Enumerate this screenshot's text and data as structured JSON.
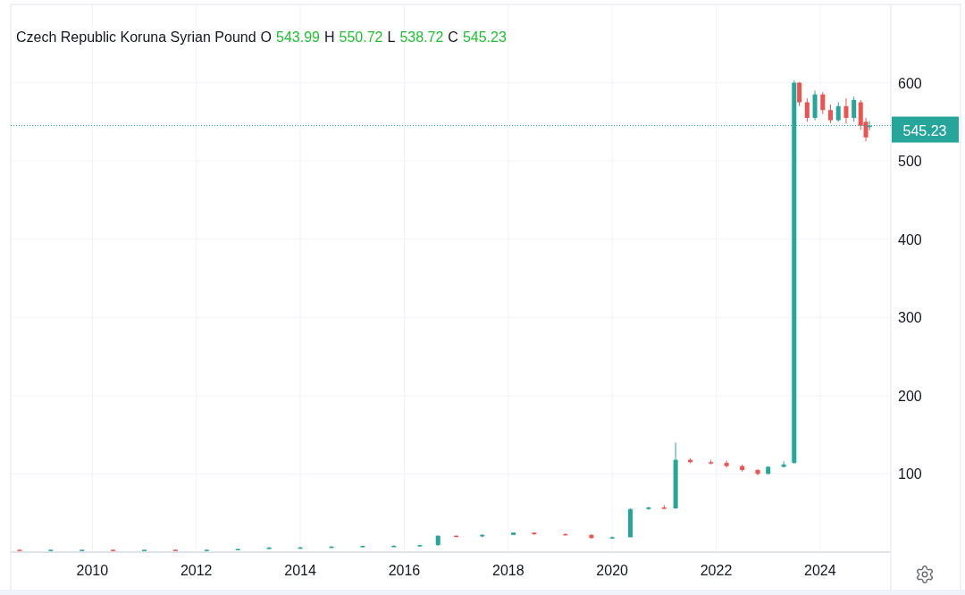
{
  "legend": {
    "fields": [
      {
        "label": "O",
        "value": "543.99"
      },
      {
        "label": "H",
        "value": "550.72"
      },
      {
        "label": "L",
        "value": "538.72"
      },
      {
        "label": "C",
        "value": "545.23"
      }
    ]
  },
  "price_label": "545.23",
  "chart_data": {
    "type": "candlestick",
    "title": "Czech Republic Koruna Syrian Pound",
    "grid": true,
    "ref_lines": [
      {
        "axis": "y",
        "value": 545.23
      }
    ],
    "xlim": [
      2008.43,
      2025.36
    ],
    "ylim": [
      0,
      700
    ],
    "xticks": [
      {
        "value": 2010,
        "label": "2010"
      },
      {
        "value": 2012,
        "label": "2012"
      },
      {
        "value": 2014,
        "label": "2014"
      },
      {
        "value": 2016,
        "label": "2016"
      },
      {
        "value": 2018,
        "label": "2018"
      },
      {
        "value": 2020,
        "label": "2020"
      },
      {
        "value": 2022,
        "label": "2022"
      },
      {
        "value": 2024,
        "label": "2024"
      }
    ],
    "yticks": [
      {
        "value": 100,
        "label": "100"
      },
      {
        "value": 200,
        "label": "200"
      },
      {
        "value": 300,
        "label": "300"
      },
      {
        "value": 400,
        "label": "400"
      },
      {
        "value": 500,
        "label": "500"
      },
      {
        "value": 600,
        "label": "600"
      }
    ],
    "x": [
      2008.6,
      2009.2,
      2009.8,
      2010.4,
      2011.0,
      2011.6,
      2012.2,
      2012.8,
      2013.4,
      2014.0,
      2014.6,
      2015.2,
      2015.8,
      2016.3,
      2016.65,
      2017.0,
      2017.5,
      2018.1,
      2018.5,
      2019.1,
      2019.6,
      2020.0,
      2020.35,
      2020.7,
      2021.0,
      2021.22,
      2021.5,
      2021.9,
      2022.2,
      2022.5,
      2022.8,
      2023.0,
      2023.3,
      2023.5,
      2023.6,
      2023.75,
      2023.9,
      2024.05,
      2024.2,
      2024.35,
      2024.5,
      2024.65,
      2024.78,
      2024.88,
      2024.95
    ],
    "ohlc": [
      [
        3,
        3,
        2,
        2
      ],
      [
        2,
        3,
        2,
        3
      ],
      [
        3,
        3,
        2,
        3
      ],
      [
        3,
        3,
        2,
        2
      ],
      [
        2,
        3,
        2,
        3
      ],
      [
        3,
        3,
        2,
        2
      ],
      [
        2,
        3,
        2,
        3
      ],
      [
        3,
        4,
        3,
        4
      ],
      [
        4,
        6,
        4,
        6
      ],
      [
        6,
        7,
        5,
        6
      ],
      [
        6,
        8,
        6,
        7
      ],
      [
        7,
        8,
        6,
        8
      ],
      [
        8,
        9,
        7,
        8
      ],
      [
        8,
        9,
        7,
        9
      ],
      [
        9,
        21,
        8,
        21
      ],
      [
        21,
        21,
        19,
        20
      ],
      [
        20,
        23,
        19,
        22
      ],
      [
        22,
        25,
        22,
        25
      ],
      [
        25,
        25,
        22,
        23
      ],
      [
        23,
        24,
        22,
        22
      ],
      [
        22,
        23,
        17,
        18
      ],
      [
        18,
        20,
        17,
        19
      ],
      [
        19,
        56,
        19,
        55
      ],
      [
        55,
        58,
        54,
        57
      ],
      [
        57,
        60,
        55,
        56
      ],
      [
        56,
        140,
        55,
        118
      ],
      [
        118,
        120,
        114,
        115
      ],
      [
        115,
        118,
        112,
        114
      ],
      [
        114,
        117,
        108,
        110
      ],
      [
        110,
        112,
        103,
        105
      ],
      [
        105,
        106,
        98,
        100
      ],
      [
        100,
        110,
        99,
        109
      ],
      [
        109,
        116,
        108,
        112
      ],
      [
        114,
        603,
        113,
        600
      ],
      [
        600,
        601,
        570,
        575
      ],
      [
        575,
        580,
        550,
        555
      ],
      [
        555,
        590,
        552,
        585
      ],
      [
        585,
        588,
        560,
        565
      ],
      [
        565,
        572,
        548,
        552
      ],
      [
        552,
        575,
        550,
        570
      ],
      [
        570,
        580,
        548,
        555
      ],
      [
        555,
        582,
        550,
        578
      ],
      [
        575,
        578,
        540,
        545
      ],
      [
        550,
        555,
        525,
        530
      ],
      [
        544,
        551,
        539,
        545
      ]
    ]
  }
}
